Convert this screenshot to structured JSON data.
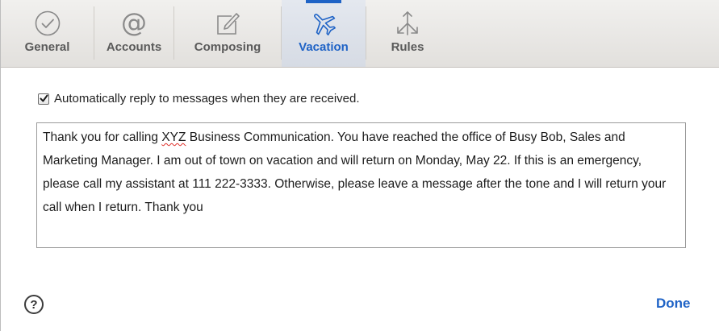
{
  "toolbar": {
    "tabs": [
      {
        "label": "General",
        "icon": "checkmark-circle-icon",
        "active": false
      },
      {
        "label": "Accounts",
        "icon": "at-sign-icon",
        "active": false
      },
      {
        "label": "Composing",
        "icon": "compose-icon",
        "active": false
      },
      {
        "label": "Vacation",
        "icon": "airplane-icon",
        "active": true
      },
      {
        "label": "Rules",
        "icon": "arrows-icon",
        "active": false
      }
    ]
  },
  "vacation": {
    "auto_reply_checked": true,
    "auto_reply_label": "Automatically reply to messages when they are received.",
    "message_before": "Thank you for calling ",
    "message_misspelled": "XYZ",
    "message_after": " Business Communication. You have reached the office of Busy Bob, Sales and Marketing Manager. I am out of town on vacation and will return on Monday, May 22. If this is an emergency, please call my assistant at 111 222-3333. Otherwise, please leave a message after the tone and I will return your call when I return. Thank you"
  },
  "footer": {
    "help_label": "?",
    "done_label": "Done"
  },
  "colors": {
    "accent": "#1f63c6",
    "toolbar_bg": "#e8e6e3",
    "icon_gray": "#8a8a8a"
  }
}
